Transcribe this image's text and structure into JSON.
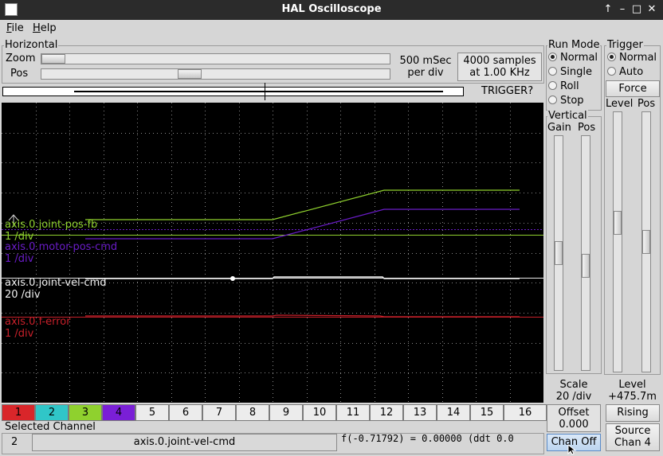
{
  "window": {
    "title": "HAL Oscilloscope",
    "buttons": [
      "↑",
      "–",
      "□",
      "✕"
    ]
  },
  "menu": [
    {
      "first": "F",
      "rest": "ile"
    },
    {
      "first": "H",
      "rest": "elp"
    }
  ],
  "horizontal": {
    "label": "Horizontal",
    "zoom_label": "Zoom",
    "pos_label": "Pos",
    "zoom_fraction": 0.0,
    "pos_fraction": 0.42,
    "rate_line1": "500 mSec",
    "rate_line2": "per div",
    "samples_line1": "4000 samples",
    "samples_line2": "at 1.00 KHz",
    "trigger_status": "TRIGGER?"
  },
  "channels_traces": [
    {
      "name": "axis.0.joint-pos-fb",
      "scale": "1 /div",
      "color": "#8fd12e"
    },
    {
      "name": "axis.0.motor-pos-cmd",
      "scale": "1 /div",
      "color": "#6a1cc8"
    },
    {
      "name": "axis.0.joint-vel-cmd",
      "scale": "20 /div",
      "color": "#f0f0f0"
    },
    {
      "name": "axis.0.f-error",
      "scale": "1 /div",
      "color": "#c8202a"
    }
  ],
  "channel_buttons": [
    {
      "label": "1",
      "color": "#d9262a"
    },
    {
      "label": "2",
      "color": "#30c6c8"
    },
    {
      "label": "3",
      "color": "#8fd12e"
    },
    {
      "label": "4",
      "color": "#7a1fd6"
    },
    {
      "label": "5",
      "color": ""
    },
    {
      "label": "6",
      "color": ""
    },
    {
      "label": "7",
      "color": ""
    },
    {
      "label": "8",
      "color": ""
    },
    {
      "label": "9",
      "color": ""
    },
    {
      "label": "10",
      "color": ""
    },
    {
      "label": "11",
      "color": ""
    },
    {
      "label": "12",
      "color": ""
    },
    {
      "label": "13",
      "color": ""
    },
    {
      "label": "14",
      "color": ""
    },
    {
      "label": "15",
      "color": ""
    },
    {
      "label": "16",
      "color": ""
    }
  ],
  "selected_channel": {
    "label": "Selected Channel",
    "number": "2",
    "signal": "axis.0.joint-vel-cmd",
    "readout": "f(-0.71792) =  0.00000 (ddt  0.0"
  },
  "run_mode": {
    "label": "Run Mode",
    "options": [
      "Normal",
      "Single",
      "Roll",
      "Stop"
    ],
    "selected": "Normal"
  },
  "trigger": {
    "label": "Trigger",
    "options": [
      "Normal",
      "Auto"
    ],
    "selected": "Normal",
    "force_label": "Force",
    "level_label": "Level",
    "pos_label": "Pos",
    "level_value_label": "Level",
    "level_value": "+475.7m",
    "edge_label": "Rising",
    "source_line1": "Source",
    "source_line2": "Chan  4",
    "level_fraction": 0.42,
    "pos_fraction": 0.5
  },
  "vertical": {
    "label": "Vertical",
    "gain_label": "Gain",
    "pos_label": "Pos",
    "gain_fraction": 0.5,
    "pos_fraction": 0.56,
    "scale_label": "Scale",
    "scale_value": "20 /div",
    "offset_label": "Offset",
    "offset_value": "0.000",
    "chan_off_label": "Chan Off"
  },
  "colors": {
    "background": "#d6d6d6",
    "scope_bg": "#000000",
    "grid": "#8a8a8a"
  }
}
